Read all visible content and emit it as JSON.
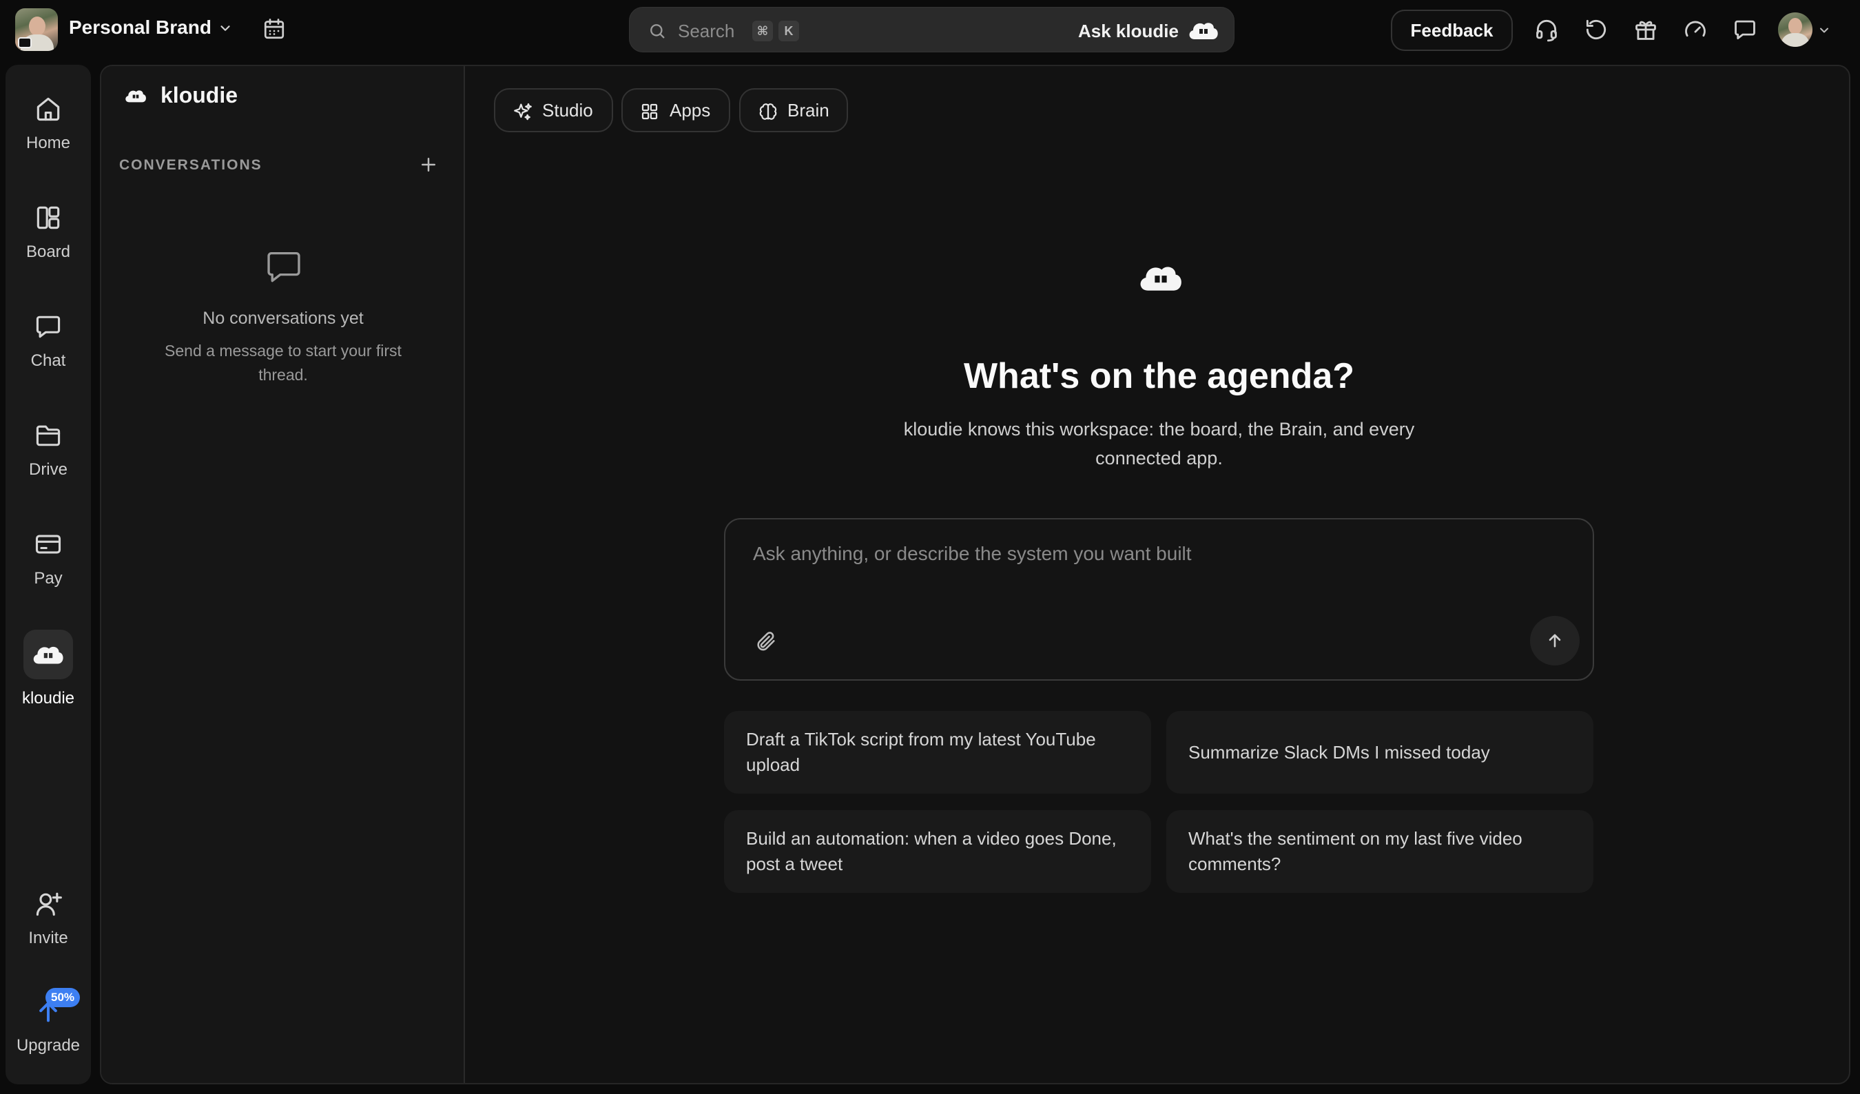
{
  "workspace": {
    "name": "Personal Brand"
  },
  "search": {
    "placeholder": "Search",
    "shortcut_keys": [
      "⌘",
      "K"
    ],
    "ask_label": "Ask kloudie"
  },
  "topbar": {
    "feedback_label": "Feedback",
    "icons": [
      "headset-icon",
      "history-icon",
      "gift-icon",
      "gauge-icon",
      "message-icon"
    ]
  },
  "nav": {
    "items": [
      {
        "label": "Home",
        "icon": "home-icon"
      },
      {
        "label": "Board",
        "icon": "board-icon"
      },
      {
        "label": "Chat",
        "icon": "chat-icon"
      },
      {
        "label": "Drive",
        "icon": "folder-icon"
      },
      {
        "label": "Pay",
        "icon": "card-icon"
      },
      {
        "label": "kloudie",
        "icon": "kloudie-icon",
        "active": true
      }
    ],
    "invite_label": "Invite",
    "upgrade_label": "Upgrade",
    "upgrade_badge": "50%"
  },
  "conversations": {
    "title": "kloudie",
    "section_label": "CONVERSATIONS",
    "empty_title": "No conversations yet",
    "empty_subtitle": "Send a message to start your first thread."
  },
  "main": {
    "tabs": [
      {
        "label": "Studio",
        "icon": "sparkles-icon"
      },
      {
        "label": "Apps",
        "icon": "grid-icon"
      },
      {
        "label": "Brain",
        "icon": "brain-icon"
      }
    ],
    "hero_title": "What's on the agenda?",
    "hero_subtitle": "kloudie knows this workspace: the board, the Brain, and every connected app.",
    "composer_placeholder": "Ask anything, or describe the system you want built",
    "suggestions": [
      "Draft a TikTok script from my latest YouTube upload",
      "Summarize Slack DMs I missed today",
      "Build an automation: when a video goes Done, post a tweet",
      "What's the sentiment on my last five video comments?"
    ]
  },
  "colors": {
    "accent": "#3d7ff2",
    "background": "#0b0b0b",
    "panel": "#121212"
  }
}
